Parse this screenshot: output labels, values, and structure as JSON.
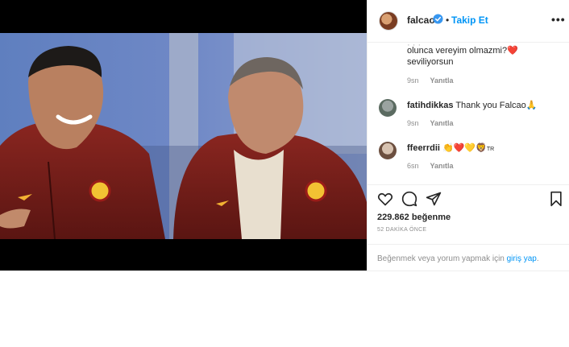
{
  "header": {
    "username": "falcao",
    "separator": "•",
    "follow_label": "Takip Et",
    "more_label": "•••",
    "icons": {
      "avatar": "profile-avatar",
      "verified": "verified-badge-icon",
      "more": "more-options-icon"
    }
  },
  "comments": [
    {
      "user": "",
      "text_line1": "olunca vereyim olmazmi?❤️",
      "text_line2": "seviliyorsun",
      "time": "9sn",
      "reply": "Yanıtla"
    },
    {
      "user": "fatihdikkas",
      "text": "Thank you Falcao🙏",
      "time": "9sn",
      "reply": "Yanıtla"
    },
    {
      "user": "ffeerrdii",
      "text": "👏❤️💛🦁",
      "suffix": "TR",
      "time": "6sn",
      "reply": "Yanıtla"
    }
  ],
  "actions": {
    "icons": [
      "heart-icon",
      "comment-icon",
      "share-icon",
      "bookmark-icon"
    ],
    "likes": "229.862 beğenme",
    "time_ago": "52 DAKİKA ÖNCE"
  },
  "login": {
    "prefix": "Beğenmek veya yorum yapmak için ",
    "link": "giriş yap",
    "suffix": "."
  },
  "colors": {
    "accent": "#0095f6",
    "text": "#262626",
    "muted": "#8e8e8e",
    "border": "#efefef",
    "jacket": "#7d2020"
  }
}
